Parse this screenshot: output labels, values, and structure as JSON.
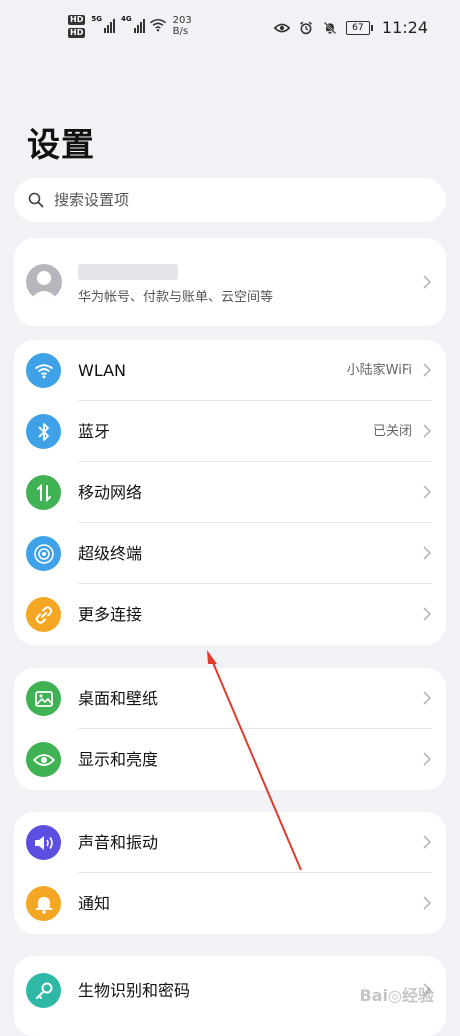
{
  "status_bar": {
    "hd1": "HD",
    "hd2": "HD",
    "gen1": "5G",
    "gen2": "4G",
    "speed_value": "203",
    "speed_unit": "B/s",
    "battery": "67",
    "time": "11:24"
  },
  "page_title": "设置",
  "search": {
    "placeholder": "搜索设置项"
  },
  "account": {
    "subtitle": "华为帐号、付款与账单、云空间等"
  },
  "groups": [
    {
      "items": [
        {
          "label": "WLAN",
          "value": "小陆家WiFi",
          "icon": "wifi-icon",
          "color": "#3fa2e8"
        },
        {
          "label": "蓝牙",
          "value": "已关闭",
          "icon": "bluetooth-icon",
          "color": "#3fa2e8"
        },
        {
          "label": "移动网络",
          "value": "",
          "icon": "mobile-network-icon",
          "color": "#3fb253"
        },
        {
          "label": "超级终端",
          "value": "",
          "icon": "super-device-icon",
          "color": "#3fa2e8"
        },
        {
          "label": "更多连接",
          "value": "",
          "icon": "link-icon",
          "color": "#f5a623"
        }
      ]
    },
    {
      "items": [
        {
          "label": "桌面和壁纸",
          "icon": "wallpaper-icon",
          "color": "#3fb253"
        },
        {
          "label": "显示和亮度",
          "icon": "eye-icon",
          "color": "#3fb253"
        }
      ]
    },
    {
      "items": [
        {
          "label": "声音和振动",
          "icon": "speaker-icon",
          "color": "#5b4ee0"
        },
        {
          "label": "通知",
          "icon": "bell-icon",
          "color": "#f5a623"
        }
      ]
    },
    {
      "items": [
        {
          "label": "生物识别和密码",
          "icon": "key-icon",
          "color": "#2fb8a6"
        }
      ]
    }
  ],
  "annotation_color": "#e03a2e"
}
